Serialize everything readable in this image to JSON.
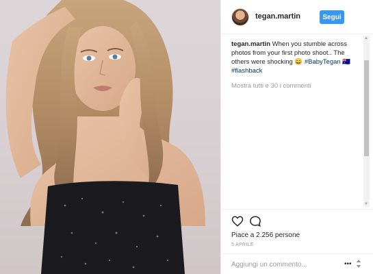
{
  "post": {
    "username": "tegan.martin",
    "follow_label": "Segui",
    "caption": {
      "user": "tegan.martin",
      "text": " When you stumble across photos from your first photo shoot.. The others were shocking 😄 ",
      "tag1": "#BabyTegan",
      "flags": " 🇦🇺 ",
      "tag2": "#flashback"
    },
    "view_all_comments": "Mostra tutti e 30 i commenti",
    "likes": "Piace a 2.256 persone",
    "date": "5 aprile",
    "comment_placeholder": "Aggiungi un commento..."
  },
  "icons": {
    "like": "heart-outline-icon",
    "comment": "speech-bubble-icon",
    "more": "more-options-icon"
  },
  "colors": {
    "accent": "#3897f0",
    "hashtag": "#003569",
    "muted": "#999999"
  }
}
